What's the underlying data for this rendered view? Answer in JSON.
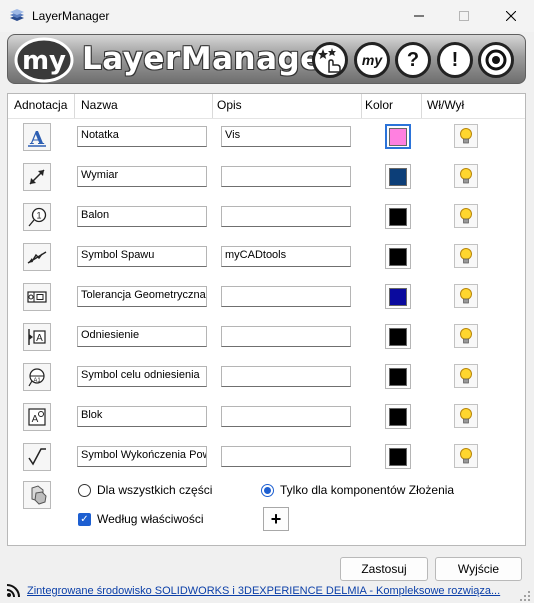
{
  "window": {
    "title": "LayerManager"
  },
  "banner": {
    "logo_text": "my",
    "title": "LayerManager",
    "my_button": "my",
    "help_glyph": "?",
    "info_glyph": "!"
  },
  "table": {
    "headers": [
      "Adnotacja",
      "Nazwa",
      "Opis",
      "Kolor",
      "Wł/Wył"
    ],
    "rows": [
      {
        "icon": "note-icon",
        "name": "Notatka",
        "desc": "Vis",
        "color": "#ff80e0"
      },
      {
        "icon": "dimension-icon",
        "name": "Wymiar",
        "desc": "",
        "color": "#0c3e78"
      },
      {
        "icon": "balloon-icon",
        "name": "Balon",
        "desc": "",
        "color": "#000000"
      },
      {
        "icon": "weld-symbol-icon",
        "name": "Symbol Spawu",
        "desc": "myCADtools",
        "color": "#000000"
      },
      {
        "icon": "geometric-tolerance-icon",
        "name": "Tolerancja Geometryczna",
        "desc": "",
        "color": "#0a0a9e"
      },
      {
        "icon": "datum-icon",
        "name": "Odniesienie",
        "desc": "",
        "color": "#000000"
      },
      {
        "icon": "datum-target-icon",
        "name": "Symbol celu odniesienia",
        "desc": "",
        "color": "#000000"
      },
      {
        "icon": "block-icon",
        "name": "Blok",
        "desc": "",
        "color": "#000000"
      },
      {
        "icon": "surface-finish-icon",
        "name": "Symbol Wykończenia Pow",
        "desc": "",
        "color": "#000000"
      }
    ]
  },
  "options": {
    "all_parts": "Dla wszystkich części",
    "assembly_only": "Tylko dla komponentów Złożenia",
    "by_property": "Według właściwości",
    "plus": "+"
  },
  "buttons": {
    "apply": "Zastosuj",
    "exit": "Wyjście"
  },
  "status": {
    "link": "Zintegrowane środowisko SOLIDWORKS i 3DEXPERIENCE DELMIA - Kompleksowe rozwiąza..."
  }
}
